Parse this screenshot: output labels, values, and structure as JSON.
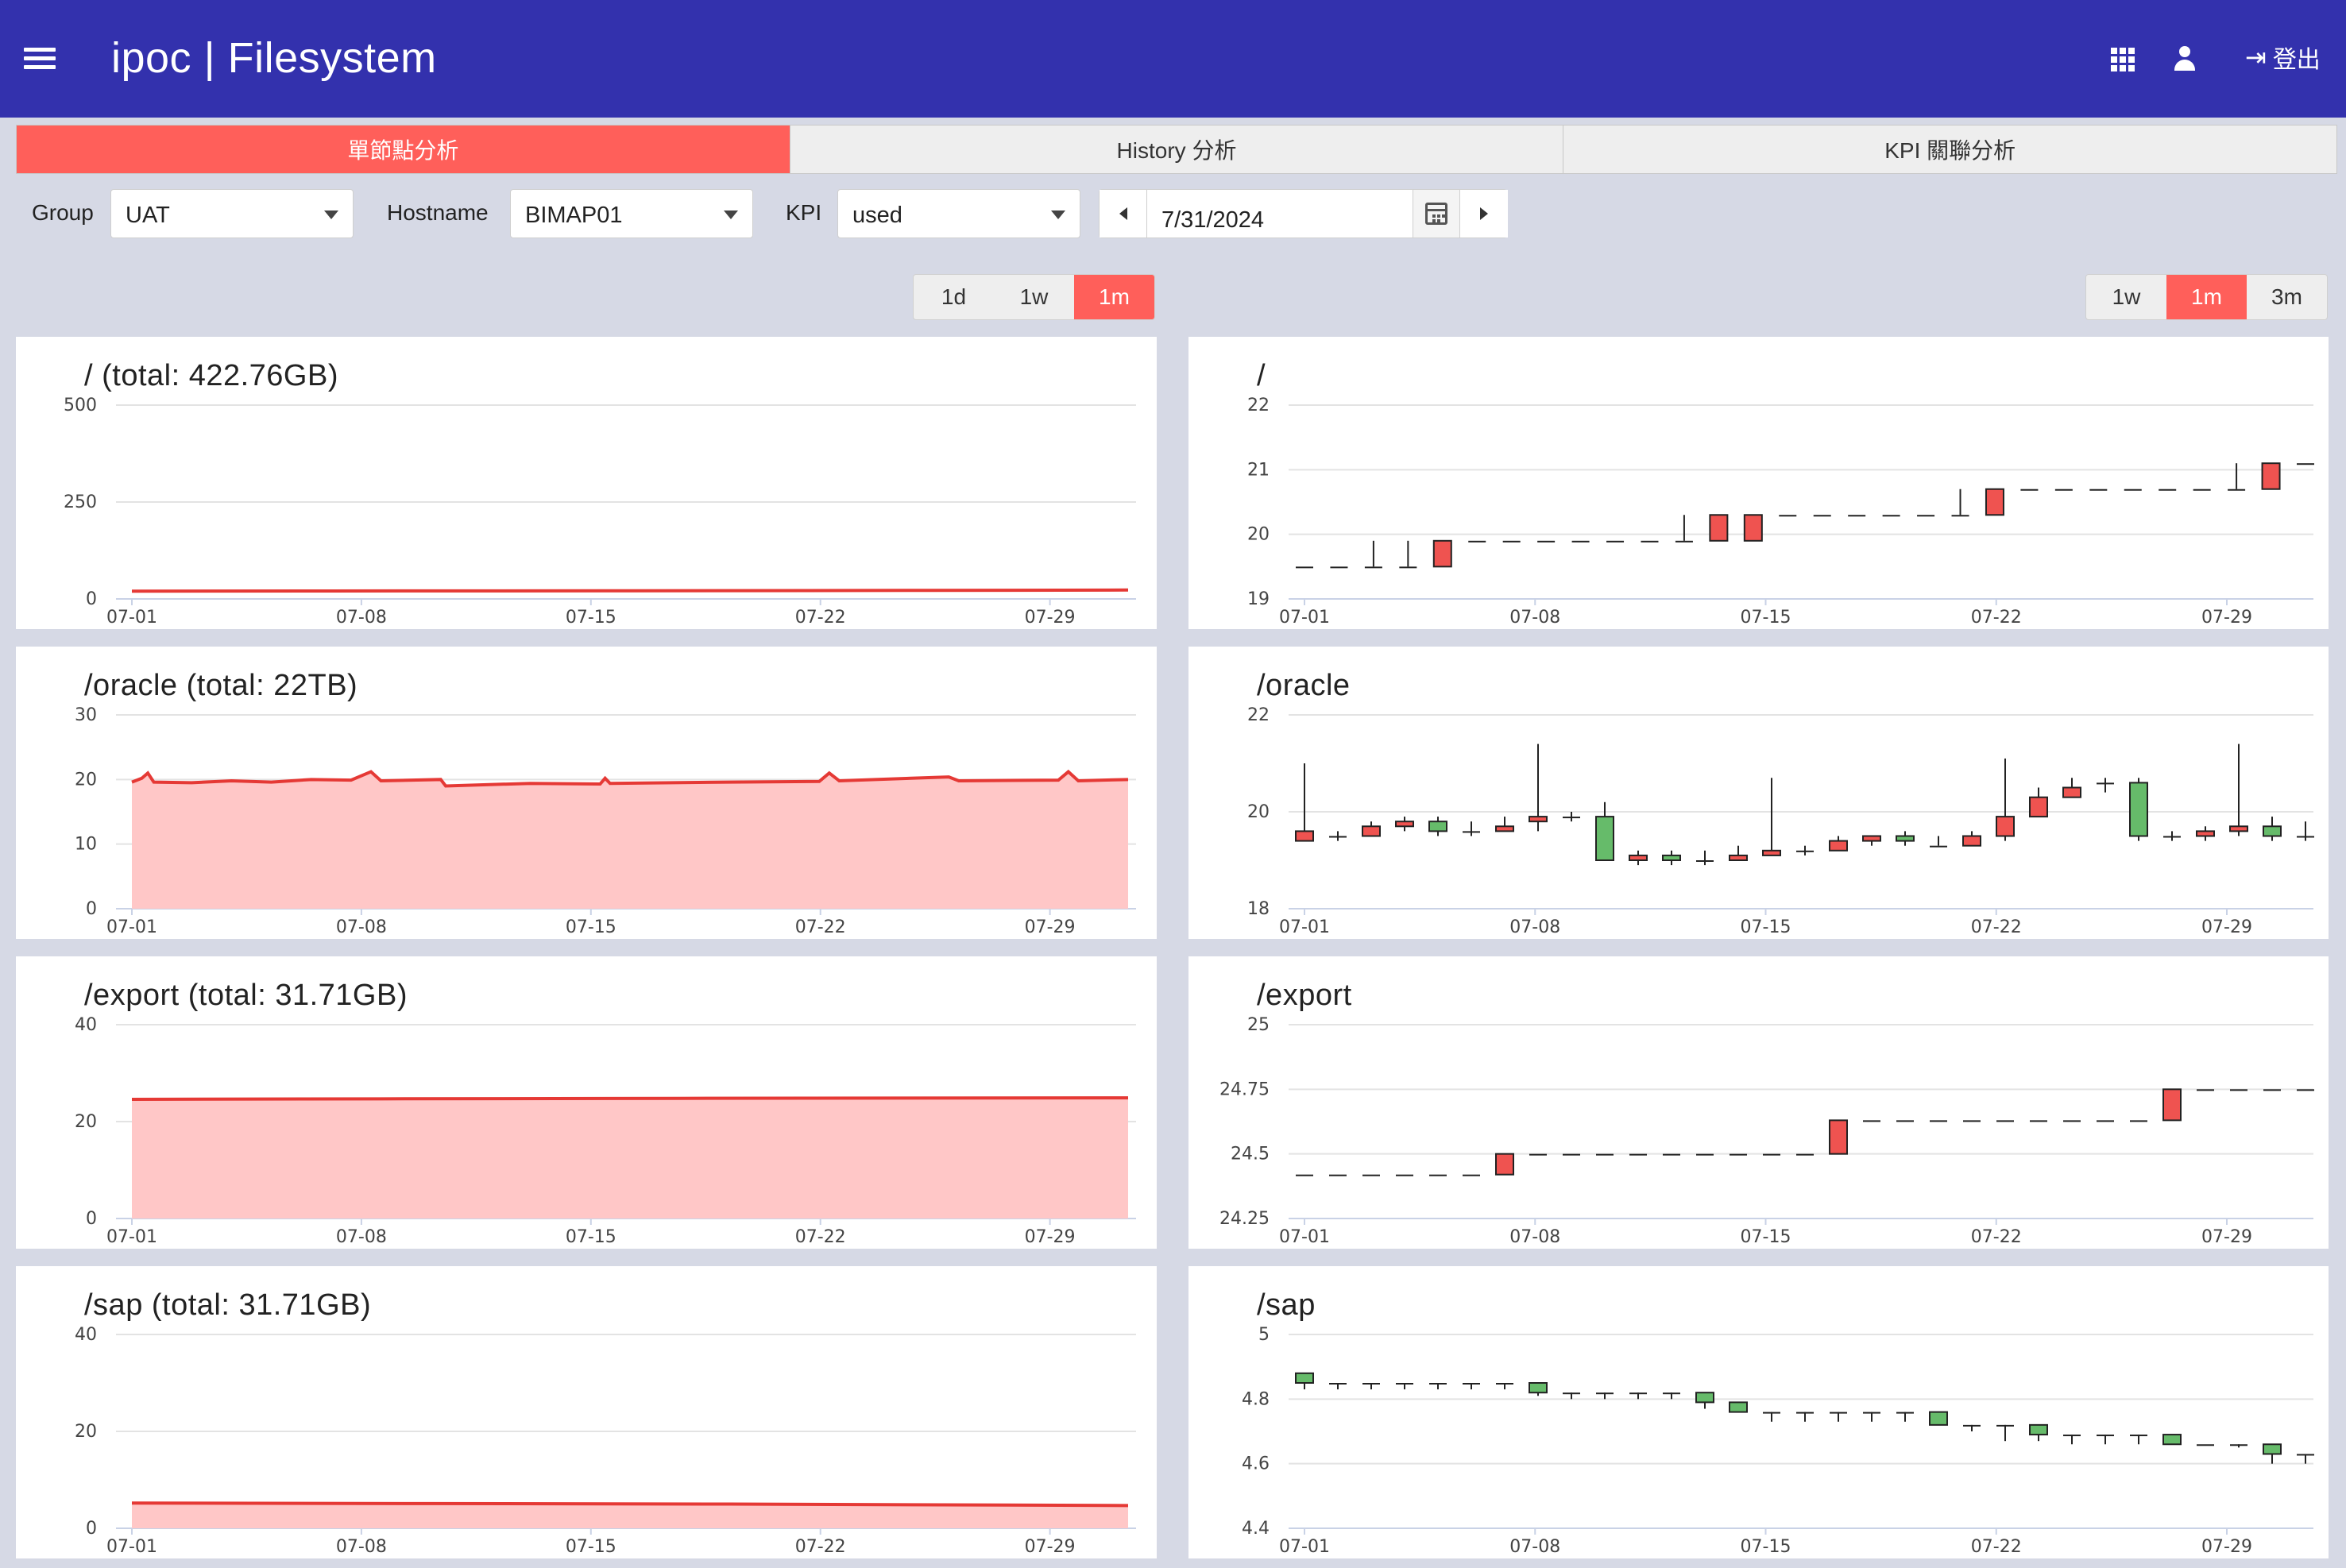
{
  "app": {
    "title": "ipoc | Filesystem",
    "logout_label": "登出"
  },
  "tabs": [
    {
      "label": "單節點分析",
      "active": true
    },
    {
      "label": "History 分析",
      "active": false
    },
    {
      "label": "KPI 關聯分析",
      "active": false
    }
  ],
  "filters": {
    "group_label": "Group",
    "group_value": "UAT",
    "hostname_label": "Hostname",
    "hostname_value": "BIMAP01",
    "kpi_label": "KPI",
    "kpi_value": "used",
    "date_value": "7/31/2024"
  },
  "left_ranges": {
    "options": [
      "1d",
      "1w",
      "1m"
    ],
    "selected": "1m"
  },
  "right_ranges": {
    "options": [
      "1w",
      "1m",
      "3m"
    ],
    "selected": "1m"
  },
  "colors": {
    "accent": "#ff5f5a",
    "appbar": "#3331ad",
    "line": "#e53935",
    "area": "#ffc7c7",
    "up": "#ef5350",
    "down": "#66bb6a"
  },
  "x_ticks": [
    "07-01",
    "07-08",
    "07-15",
    "07-22",
    "07-29"
  ],
  "chart_data": [
    {
      "type": "line",
      "title": "/ (total: 422.76GB)",
      "xlabel": "",
      "ylabel": "",
      "ylim": [
        0,
        500
      ],
      "yticks": [
        0,
        250,
        500
      ],
      "area": false,
      "points": [
        [
          0,
          20
        ],
        [
          0.2,
          20.5
        ],
        [
          0.5,
          21
        ],
        [
          0.8,
          22
        ],
        [
          1,
          23
        ]
      ]
    },
    {
      "type": "area",
      "title": "/oracle (total: 22TB)",
      "xlabel": "",
      "ylabel": "",
      "ylim": [
        0,
        30
      ],
      "yticks": [
        0,
        10,
        20,
        30
      ],
      "area": true,
      "points": [
        [
          0,
          19.6
        ],
        [
          0.01,
          20.2
        ],
        [
          0.016,
          21
        ],
        [
          0.022,
          19.6
        ],
        [
          0.06,
          19.5
        ],
        [
          0.1,
          19.8
        ],
        [
          0.14,
          19.6
        ],
        [
          0.18,
          20
        ],
        [
          0.22,
          19.9
        ],
        [
          0.24,
          21.2
        ],
        [
          0.25,
          19.8
        ],
        [
          0.31,
          20
        ],
        [
          0.315,
          19
        ],
        [
          0.4,
          19.4
        ],
        [
          0.47,
          19.3
        ],
        [
          0.475,
          20.2
        ],
        [
          0.48,
          19.4
        ],
        [
          0.6,
          19.6
        ],
        [
          0.69,
          19.7
        ],
        [
          0.7,
          21
        ],
        [
          0.71,
          19.8
        ],
        [
          0.82,
          20.4
        ],
        [
          0.83,
          19.8
        ],
        [
          0.93,
          19.9
        ],
        [
          0.94,
          21.2
        ],
        [
          0.95,
          19.8
        ],
        [
          1,
          20
        ]
      ]
    },
    {
      "type": "area",
      "title": "/export (total: 31.71GB)",
      "xlabel": "",
      "ylabel": "",
      "ylim": [
        0,
        40
      ],
      "yticks": [
        0,
        20,
        40
      ],
      "area": true,
      "points": [
        [
          0,
          24.6
        ],
        [
          0.25,
          24.7
        ],
        [
          0.55,
          24.8
        ],
        [
          1,
          24.9
        ]
      ]
    },
    {
      "type": "area",
      "title": "/sap (total: 31.71GB)",
      "xlabel": "",
      "ylabel": "",
      "ylim": [
        0,
        40
      ],
      "yticks": [
        0,
        20,
        40
      ],
      "area": true,
      "points": [
        [
          0,
          5.2
        ],
        [
          0.3,
          5.1
        ],
        [
          0.6,
          5
        ],
        [
          1,
          4.7
        ]
      ]
    },
    {
      "type": "candlestick",
      "title": "/",
      "xlabel": "",
      "ylabel": "",
      "ylim": [
        19,
        22
      ],
      "yticks": [
        19,
        20,
        21,
        22
      ],
      "candles": [
        [
          19.5,
          19.5,
          19.5,
          19.5
        ],
        [
          19.5,
          19.5,
          19.5,
          19.5
        ],
        [
          19.5,
          19.5,
          19.5,
          19.9
        ],
        [
          19.5,
          19.5,
          19.5,
          19.9
        ],
        [
          19.5,
          19.9,
          19.5,
          19.9
        ],
        [
          19.9,
          19.9,
          19.9,
          19.9
        ],
        [
          19.9,
          19.9,
          19.9,
          19.9
        ],
        [
          19.9,
          19.9,
          19.9,
          19.9
        ],
        [
          19.9,
          19.9,
          19.9,
          19.9
        ],
        [
          19.9,
          19.9,
          19.9,
          19.9
        ],
        [
          19.9,
          19.9,
          19.9,
          19.9
        ],
        [
          19.9,
          19.9,
          19.9,
          20.3
        ],
        [
          19.9,
          20.3,
          19.9,
          20.3
        ],
        [
          19.9,
          20.3,
          19.9,
          20.3
        ],
        [
          20.3,
          20.3,
          20.3,
          20.3
        ],
        [
          20.3,
          20.3,
          20.3,
          20.3
        ],
        [
          20.3,
          20.3,
          20.3,
          20.3
        ],
        [
          20.3,
          20.3,
          20.3,
          20.3
        ],
        [
          20.3,
          20.3,
          20.3,
          20.3
        ],
        [
          20.3,
          20.3,
          20.3,
          20.7
        ],
        [
          20.3,
          20.7,
          20.3,
          20.7
        ],
        [
          20.7,
          20.7,
          20.7,
          20.7
        ],
        [
          20.7,
          20.7,
          20.7,
          20.7
        ],
        [
          20.7,
          20.7,
          20.7,
          20.7
        ],
        [
          20.7,
          20.7,
          20.7,
          20.7
        ],
        [
          20.7,
          20.7,
          20.7,
          20.7
        ],
        [
          20.7,
          20.7,
          20.7,
          20.7
        ],
        [
          20.7,
          20.7,
          20.7,
          21.1
        ],
        [
          20.7,
          21.1,
          20.7,
          21.1
        ],
        [
          21.1,
          21.1,
          21.1,
          21.1
        ]
      ]
    },
    {
      "type": "candlestick",
      "title": "/oracle",
      "xlabel": "",
      "ylabel": "",
      "ylim": [
        18,
        22
      ],
      "yticks": [
        18,
        20,
        22
      ],
      "candles": [
        [
          19.4,
          19.6,
          19.4,
          21
        ],
        [
          19.5,
          19.5,
          19.4,
          19.6
        ],
        [
          19.5,
          19.7,
          19.5,
          19.8
        ],
        [
          19.7,
          19.8,
          19.6,
          19.9
        ],
        [
          19.8,
          19.6,
          19.5,
          19.9
        ],
        [
          19.6,
          19.6,
          19.5,
          19.8
        ],
        [
          19.6,
          19.7,
          19.6,
          19.9
        ],
        [
          19.8,
          19.9,
          19.6,
          21.4
        ],
        [
          19.9,
          19.9,
          19.8,
          20
        ],
        [
          19.9,
          19,
          19,
          20.2
        ],
        [
          19,
          19.1,
          18.9,
          19.2
        ],
        [
          19.1,
          19,
          18.9,
          19.2
        ],
        [
          19,
          19,
          18.9,
          19.2
        ],
        [
          19,
          19.1,
          19,
          19.3
        ],
        [
          19.1,
          19.2,
          19.1,
          20.7
        ],
        [
          19.2,
          19.2,
          19.1,
          19.3
        ],
        [
          19.2,
          19.4,
          19.2,
          19.5
        ],
        [
          19.4,
          19.5,
          19.3,
          19.5
        ],
        [
          19.5,
          19.4,
          19.3,
          19.6
        ],
        [
          19.3,
          19.3,
          19.3,
          19.5
        ],
        [
          19.3,
          19.5,
          19.3,
          19.6
        ],
        [
          19.5,
          19.9,
          19.4,
          21.1
        ],
        [
          19.9,
          20.3,
          19.9,
          20.5
        ],
        [
          20.3,
          20.5,
          20.3,
          20.7
        ],
        [
          20.6,
          20.6,
          20.4,
          20.7
        ],
        [
          20.6,
          19.5,
          19.4,
          20.7
        ],
        [
          19.5,
          19.5,
          19.4,
          19.6
        ],
        [
          19.5,
          19.6,
          19.4,
          19.7
        ],
        [
          19.6,
          19.7,
          19.5,
          21.4
        ],
        [
          19.7,
          19.5,
          19.4,
          19.9
        ],
        [
          19.5,
          19.5,
          19.4,
          19.8
        ]
      ]
    },
    {
      "type": "candlestick",
      "title": "/export",
      "xlabel": "",
      "ylabel": "",
      "ylim": [
        24.25,
        25
      ],
      "yticks": [
        24.25,
        24.5,
        24.75,
        25
      ],
      "candles": [
        [
          24.42,
          24.42,
          24.42,
          24.42
        ],
        [
          24.42,
          24.42,
          24.42,
          24.42
        ],
        [
          24.42,
          24.42,
          24.42,
          24.42
        ],
        [
          24.42,
          24.42,
          24.42,
          24.42
        ],
        [
          24.42,
          24.42,
          24.42,
          24.42
        ],
        [
          24.42,
          24.42,
          24.42,
          24.42
        ],
        [
          24.42,
          24.5,
          24.42,
          24.5
        ],
        [
          24.5,
          24.5,
          24.5,
          24.5
        ],
        [
          24.5,
          24.5,
          24.5,
          24.5
        ],
        [
          24.5,
          24.5,
          24.5,
          24.5
        ],
        [
          24.5,
          24.5,
          24.5,
          24.5
        ],
        [
          24.5,
          24.5,
          24.5,
          24.5
        ],
        [
          24.5,
          24.5,
          24.5,
          24.5
        ],
        [
          24.5,
          24.5,
          24.5,
          24.5
        ],
        [
          24.5,
          24.5,
          24.5,
          24.5
        ],
        [
          24.5,
          24.5,
          24.5,
          24.5
        ],
        [
          24.5,
          24.63,
          24.5,
          24.63
        ],
        [
          24.63,
          24.63,
          24.63,
          24.63
        ],
        [
          24.63,
          24.63,
          24.63,
          24.63
        ],
        [
          24.63,
          24.63,
          24.63,
          24.63
        ],
        [
          24.63,
          24.63,
          24.63,
          24.63
        ],
        [
          24.63,
          24.63,
          24.63,
          24.63
        ],
        [
          24.63,
          24.63,
          24.63,
          24.63
        ],
        [
          24.63,
          24.63,
          24.63,
          24.63
        ],
        [
          24.63,
          24.63,
          24.63,
          24.63
        ],
        [
          24.63,
          24.63,
          24.63,
          24.63
        ],
        [
          24.63,
          24.75,
          24.63,
          24.75
        ],
        [
          24.75,
          24.75,
          24.75,
          24.75
        ],
        [
          24.75,
          24.75,
          24.75,
          24.75
        ],
        [
          24.75,
          24.75,
          24.75,
          24.75
        ],
        [
          24.75,
          24.75,
          24.75,
          24.75
        ]
      ]
    },
    {
      "type": "candlestick",
      "title": "/sap",
      "xlabel": "",
      "ylabel": "",
      "ylim": [
        4.4,
        5
      ],
      "yticks": [
        4.4,
        4.6,
        4.8,
        5
      ],
      "candles": [
        [
          4.88,
          4.85,
          4.83,
          4.88
        ],
        [
          4.85,
          4.85,
          4.83,
          4.85
        ],
        [
          4.85,
          4.85,
          4.83,
          4.85
        ],
        [
          4.85,
          4.85,
          4.83,
          4.85
        ],
        [
          4.85,
          4.85,
          4.83,
          4.85
        ],
        [
          4.85,
          4.85,
          4.83,
          4.85
        ],
        [
          4.85,
          4.85,
          4.83,
          4.85
        ],
        [
          4.85,
          4.82,
          4.81,
          4.85
        ],
        [
          4.82,
          4.82,
          4.8,
          4.82
        ],
        [
          4.82,
          4.82,
          4.8,
          4.82
        ],
        [
          4.82,
          4.82,
          4.8,
          4.82
        ],
        [
          4.82,
          4.82,
          4.8,
          4.82
        ],
        [
          4.82,
          4.79,
          4.77,
          4.82
        ],
        [
          4.79,
          4.76,
          4.76,
          4.79
        ],
        [
          4.76,
          4.76,
          4.73,
          4.76
        ],
        [
          4.76,
          4.76,
          4.73,
          4.76
        ],
        [
          4.76,
          4.76,
          4.73,
          4.76
        ],
        [
          4.76,
          4.76,
          4.73,
          4.76
        ],
        [
          4.76,
          4.76,
          4.73,
          4.76
        ],
        [
          4.76,
          4.72,
          4.72,
          4.76
        ],
        [
          4.72,
          4.72,
          4.7,
          4.72
        ],
        [
          4.72,
          4.72,
          4.67,
          4.72
        ],
        [
          4.72,
          4.69,
          4.67,
          4.72
        ],
        [
          4.69,
          4.69,
          4.66,
          4.69
        ],
        [
          4.69,
          4.69,
          4.66,
          4.69
        ],
        [
          4.69,
          4.69,
          4.66,
          4.69
        ],
        [
          4.69,
          4.66,
          4.66,
          4.69
        ],
        [
          4.66,
          4.66,
          4.66,
          4.66
        ],
        [
          4.66,
          4.66,
          4.65,
          4.66
        ],
        [
          4.66,
          4.63,
          4.6,
          4.66
        ],
        [
          4.63,
          4.63,
          4.6,
          4.63
        ]
      ]
    }
  ]
}
